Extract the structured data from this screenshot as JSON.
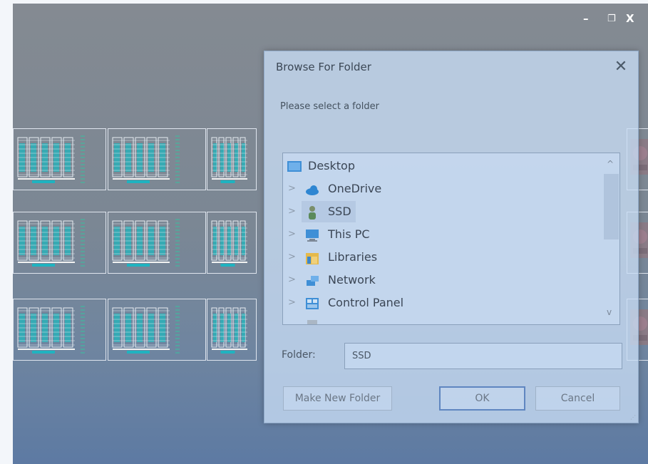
{
  "window_controls": {
    "minimize": "–",
    "maximize": "❐",
    "close": "X"
  },
  "dialog": {
    "title": "Browse For Folder",
    "close_glyph": "✕",
    "message": "Please select a folder",
    "tree": {
      "items": [
        {
          "label": "Desktop",
          "icon": "desktop-icon",
          "has_chevron": false
        },
        {
          "label": "OneDrive",
          "icon": "cloud-icon",
          "has_chevron": true
        },
        {
          "label": "SSD",
          "icon": "user-icon",
          "has_chevron": true,
          "selected": true
        },
        {
          "label": "This PC",
          "icon": "monitor-icon",
          "has_chevron": true
        },
        {
          "label": "Libraries",
          "icon": "libraries-icon",
          "has_chevron": true
        },
        {
          "label": "Network",
          "icon": "network-icon",
          "has_chevron": true
        },
        {
          "label": "Control Panel",
          "icon": "control-panel-icon",
          "has_chevron": true
        }
      ],
      "chevron": ">",
      "scroll_up": "^",
      "scroll_down": "v"
    },
    "folder_label": "Folder:",
    "folder_value": "SSD",
    "buttons": {
      "make_new_folder": "Make New Folder",
      "ok": "OK",
      "cancel": "Cancel"
    }
  }
}
